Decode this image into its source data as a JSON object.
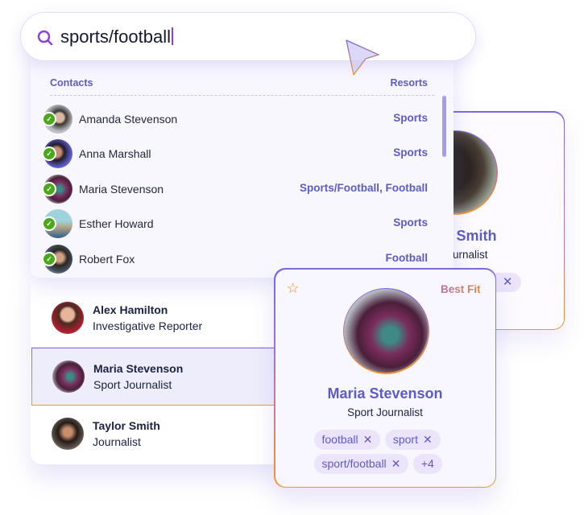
{
  "search": {
    "query": "sports/football",
    "icon": "search-icon"
  },
  "dropdown": {
    "header_left": "Contacts",
    "header_right": "Resorts",
    "rows": [
      {
        "name": "Amanda Stevenson",
        "resort": "Sports",
        "checked": true
      },
      {
        "name": "Anna Marshall",
        "resort": "Sports",
        "checked": true
      },
      {
        "name": "Maria Stevenson",
        "resort": "Sports/Football, Football",
        "checked": true
      },
      {
        "name": "Esther Howard",
        "resort": "Sports",
        "checked": true
      },
      {
        "name": "Robert Fox",
        "resort": "Football",
        "checked": true
      }
    ]
  },
  "contacts_list": [
    {
      "name": "Alex Hamilton",
      "role": "Investigative Reporter",
      "selected": false
    },
    {
      "name": "Maria Stevenson",
      "role": "Sport Journalist",
      "selected": true
    },
    {
      "name": "Taylor Smith",
      "role": "Journalist",
      "selected": false
    }
  ],
  "back_card": {
    "name": "Taylor Smith",
    "name_visible": "Smith",
    "role_visible": "ournalist"
  },
  "front_card": {
    "badge": "Best Fit",
    "name": "Maria Stevenson",
    "role": "Sport Journalist",
    "tags": [
      "football",
      "sport",
      "sport/football"
    ],
    "more": "+4",
    "remove_glyph": "✕",
    "star_glyph": "☆"
  },
  "colors": {
    "accent": "#5d5bc4",
    "gradient_start": "#7b68e6",
    "gradient_end": "#f0952f",
    "check_green": "#4aa81a"
  }
}
